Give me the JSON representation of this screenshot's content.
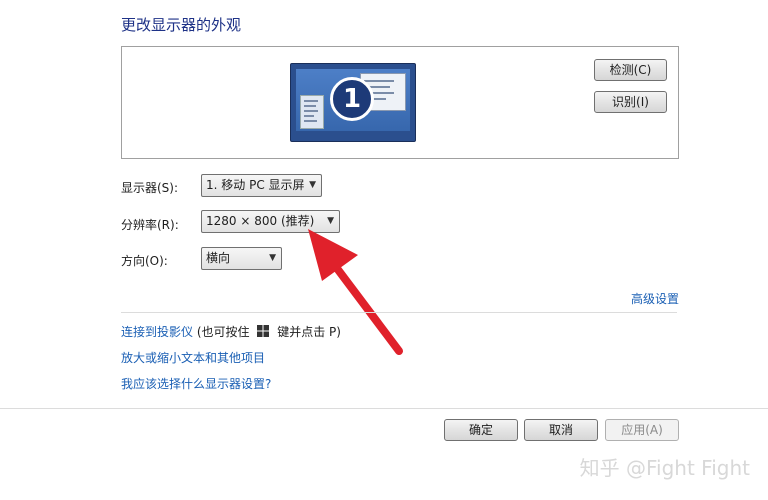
{
  "dialog": {
    "title": "更改显示器的外观",
    "monitor_number": "1",
    "detect_button": "检测(C)",
    "identify_button": "识别(I)"
  },
  "settings": {
    "display_label": "显示器(S):",
    "display_value": "1. 移动 PC 显示屏",
    "resolution_label": "分辨率(R):",
    "resolution_value": "1280 × 800 (推荐)",
    "orientation_label": "方向(O):",
    "orientation_value": "横向",
    "advanced_link": "高级设置"
  },
  "links": {
    "projector_link": "连接到投影仪",
    "projector_hint_before": "(也可按住",
    "projector_hint_after": "键并点击 P)",
    "text_size_link": "放大或缩小文本和其他项目",
    "help_link": "我应该选择什么显示器设置?"
  },
  "footer": {
    "ok_button": "确定",
    "cancel_button": "取消",
    "apply_button": "应用(A)"
  },
  "watermark": "知乎 @Fight Fight",
  "colors": {
    "title": "#1e3287",
    "link": "#1a5fb4",
    "arrow": "#e0212b"
  },
  "icons": {
    "windows_key": "windows-logo-icon",
    "dropdown": "chevron-down-icon"
  }
}
